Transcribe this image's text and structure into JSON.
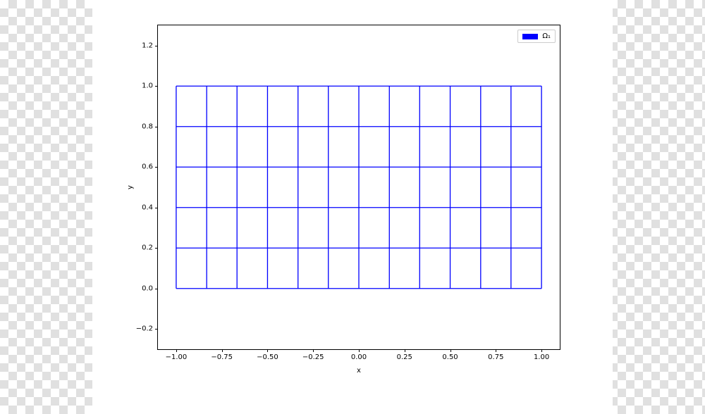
{
  "chart_data": {
    "type": "line",
    "title": "",
    "xlabel": "x",
    "ylabel": "y",
    "xlim": [
      -1.1,
      1.1
    ],
    "ylim": [
      -0.3,
      1.3
    ],
    "xticks": [
      -1.0,
      -0.75,
      -0.5,
      -0.25,
      0.0,
      0.25,
      0.5,
      0.75,
      1.0
    ],
    "yticks": [
      -0.2,
      0.0,
      0.2,
      0.4,
      0.6,
      0.8,
      1.0,
      1.2
    ],
    "xticklabels": [
      "−1.00",
      "−0.75",
      "−0.50",
      "−0.25",
      "0.00",
      "0.25",
      "0.50",
      "0.75",
      "1.00"
    ],
    "yticklabels": [
      "−0.2",
      "0.0",
      "0.2",
      "0.4",
      "0.6",
      "0.8",
      "1.0",
      "1.2"
    ],
    "legend": {
      "position": "upper right",
      "entries": [
        "Ω₁"
      ]
    },
    "series": [
      {
        "name": "Ω₁",
        "color": "#0000ff",
        "mesh": {
          "x_range": [
            -1.0,
            1.0
          ],
          "y_range": [
            0.0,
            1.0
          ],
          "x_lines": [
            -1.0,
            -0.833,
            -0.667,
            -0.5,
            -0.333,
            -0.167,
            0.0,
            0.167,
            0.333,
            0.5,
            0.667,
            0.833,
            1.0
          ],
          "y_lines": [
            0.0,
            0.2,
            0.4,
            0.6,
            0.8,
            1.0
          ]
        }
      }
    ]
  }
}
